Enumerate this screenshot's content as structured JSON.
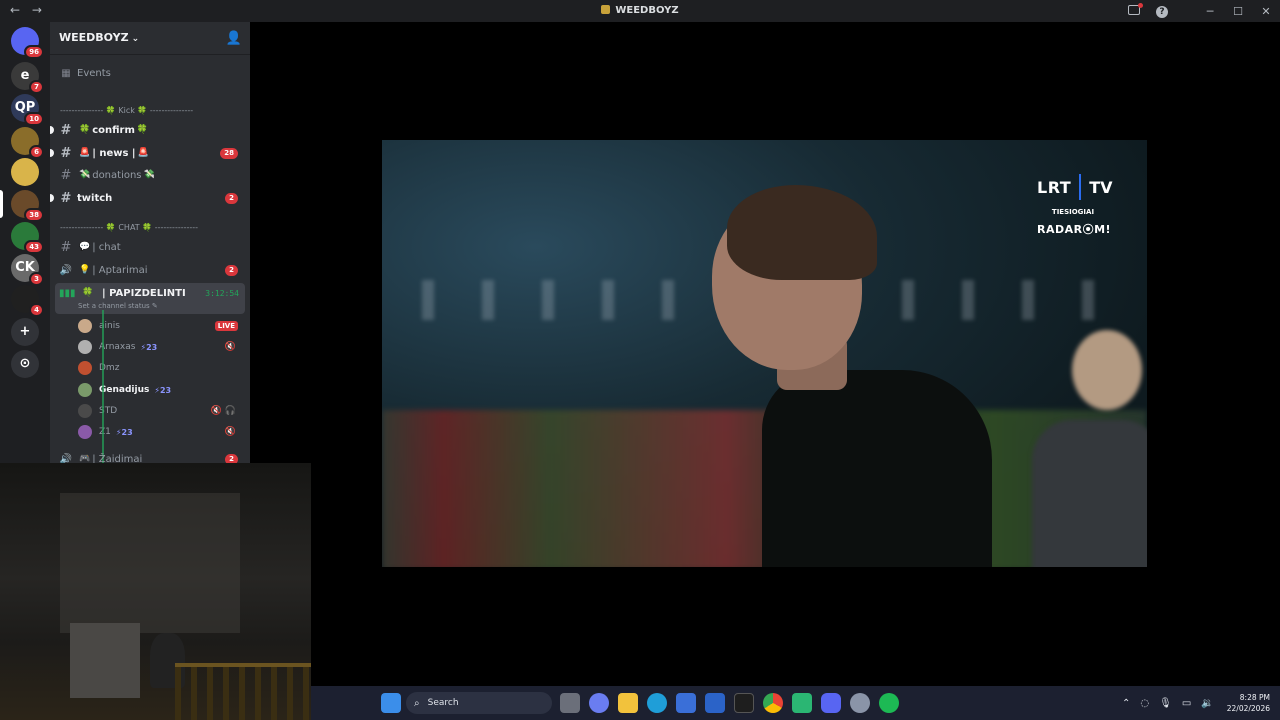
{
  "window": {
    "title": "WEEDBOYZ",
    "back": "←",
    "forward": "→",
    "minimize": "─",
    "maximize": "☐",
    "close": "✕"
  },
  "servers": [
    {
      "glyph": "",
      "badge": "96",
      "color": "#5865f2"
    },
    {
      "glyph": "e",
      "badge": "7",
      "color": "#3a3a3a"
    },
    {
      "glyph": "QP",
      "badge": "10",
      "color": "#2f3a5a"
    },
    {
      "glyph": "",
      "badge": "6",
      "color": "#8a6d2a"
    },
    {
      "glyph": "",
      "badge": "",
      "color": "#d9b44a"
    },
    {
      "glyph": "",
      "badge": "38",
      "color": "#6a4a2a"
    },
    {
      "glyph": "",
      "badge": "43",
      "color": "#2a7a3a"
    },
    {
      "glyph": "CK",
      "badge": "3",
      "color": "#6a6a6a"
    },
    {
      "glyph": "",
      "badge": "4",
      "color": "#202020"
    },
    {
      "glyph": "+",
      "badge": "",
      "color": "#313338"
    },
    {
      "glyph": "⊙",
      "badge": "",
      "color": "#313338"
    }
  ],
  "sidebar": {
    "guild_name": "WEEDBOYZ",
    "guild_chevron": "⌄",
    "events_label": "Events",
    "category_kick": "--------------- 🍀 Kick 🍀 ---------------",
    "category_chat": "--------------- 🍀 CHAT 🍀 ---------------",
    "channels": [
      {
        "name": "confirm",
        "prefix": "🍀",
        "suffix": "🍀",
        "count": ""
      },
      {
        "name": "| news |",
        "prefix": "🚨",
        "suffix": "🚨",
        "count": "28"
      },
      {
        "name": "donations",
        "prefix": "💸",
        "suffix": "💸",
        "count": ""
      },
      {
        "name": "twitch",
        "prefix": "",
        "suffix": "",
        "count": "2"
      },
      {
        "name": "| chat",
        "prefix": "💬",
        "suffix": "",
        "count": ""
      },
      {
        "name": "| Aptarimai",
        "prefix": "💡",
        "suffix": "",
        "count": "2"
      },
      {
        "name": "| Žaidimai",
        "prefix": "🎮",
        "suffix": "",
        "count": "2"
      }
    ],
    "voice_channel": {
      "name": "| PAPIZDELINTI",
      "timer": "3:12:54",
      "status": "Set a channel status ✎"
    },
    "users": [
      {
        "name": "ainis",
        "boost": "",
        "live": "LIVE",
        "mute": "",
        "color": "#c9a98a"
      },
      {
        "name": "Arnaxas",
        "boost": "⚡23",
        "live": "",
        "mute": "🔇",
        "color": "#b0b0b0"
      },
      {
        "name": "Dmz",
        "boost": "",
        "live": "",
        "mute": "",
        "color": "#c05030"
      },
      {
        "name": "Genadijus",
        "boost": "⚡23",
        "live": "",
        "mute": "",
        "color": "#7a9a6a"
      },
      {
        "name": "STD",
        "boost": "",
        "live": "",
        "mute": "🔇 🎧",
        "color": "#4a4a4a"
      },
      {
        "name": "Z1",
        "boost": "⚡23",
        "live": "",
        "mute": "🔇",
        "color": "#8a5aa8"
      }
    ]
  },
  "stream": {
    "channel_logo": "LRT",
    "channel_logo_tv": "TV",
    "live_label": "TIESIOGIAI",
    "show_label": "RADAR⦿M!"
  },
  "taskbar": {
    "search_placeholder": "Search",
    "time": "8:28 PM",
    "date": "22/02/2026"
  }
}
